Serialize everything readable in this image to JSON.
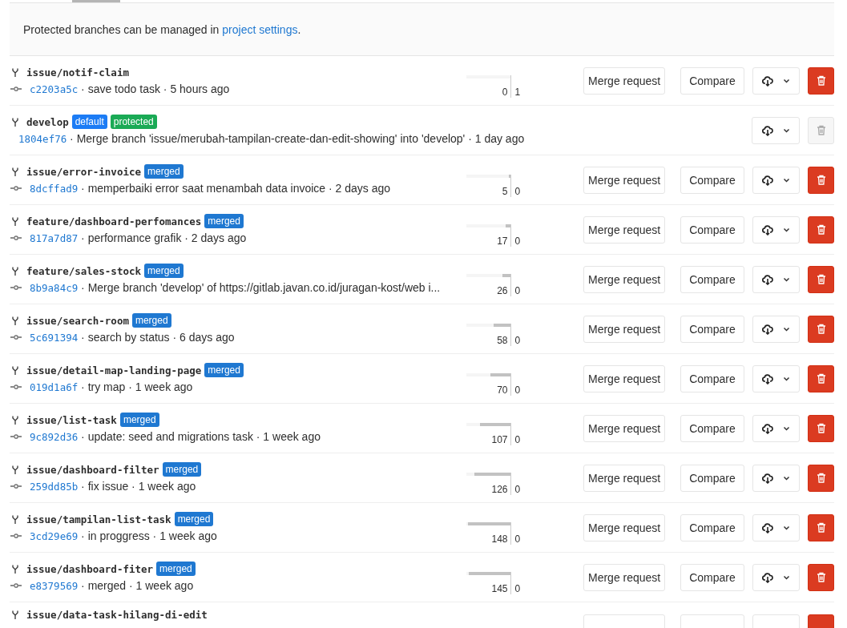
{
  "notice": {
    "text": "Protected branches can be managed in ",
    "link": "project settings",
    "end": "."
  },
  "branches": [
    {
      "name": "issue/notif-claim",
      "sha": "c2203a5c",
      "message": " · save todo task · 5 hours ago",
      "behind": "0",
      "ahead": "1",
      "level": 0,
      "actions": [
        "Merge request",
        "Compare"
      ],
      "can_delete": true
    },
    {
      "name": "develop",
      "badges": [
        {
          "label": "default",
          "kind": "default"
        },
        {
          "label": "protected",
          "kind": "protected"
        }
      ],
      "sha": "1804ef76",
      "message": " · Merge branch 'issue/merubah-tampilan-create-dan-edit-showing' into 'develop' · 1 day ago",
      "can_delete": false
    },
    {
      "name": "issue/error-invoice",
      "badges": [
        {
          "label": "merged",
          "kind": "merged"
        }
      ],
      "sha": "8dcffad9",
      "message": " · memperbaiki error saat menambah data invoice · 2 days ago",
      "behind": "5",
      "ahead": "0",
      "level": 0.03,
      "actions": [
        "Merge request",
        "Compare"
      ],
      "can_delete": true
    },
    {
      "name": "feature/dashboard-perfomances",
      "badges": [
        {
          "label": "merged",
          "kind": "merged"
        }
      ],
      "sha": "817a7d87",
      "message": " · performance grafik · 2 days ago",
      "behind": "17",
      "ahead": "0",
      "level": 0.11,
      "actions": [
        "Merge request",
        "Compare"
      ],
      "can_delete": true
    },
    {
      "name": "feature/sales-stock",
      "badges": [
        {
          "label": "merged",
          "kind": "merged"
        }
      ],
      "sha": "8b9a84c9",
      "message": " · Merge branch 'develop' of https://gitlab.javan.co.id/juragan-kost/web i...",
      "behind": "26",
      "ahead": "0",
      "level": 0.17,
      "actions": [
        "Merge request",
        "Compare"
      ],
      "can_delete": true
    },
    {
      "name": "issue/search-room",
      "badges": [
        {
          "label": "merged",
          "kind": "merged"
        }
      ],
      "sha": "5c691394",
      "message": " · search by status · 6 days ago",
      "behind": "58",
      "ahead": "0",
      "level": 0.37,
      "actions": [
        "Merge request",
        "Compare"
      ],
      "can_delete": true
    },
    {
      "name": "issue/detail-map-landing-page",
      "badges": [
        {
          "label": "merged",
          "kind": "merged"
        }
      ],
      "sha": "019d1a6f",
      "message": " · try map · 1 week ago",
      "behind": "70",
      "ahead": "0",
      "level": 0.45,
      "actions": [
        "Merge request",
        "Compare"
      ],
      "can_delete": true
    },
    {
      "name": "issue/list-task",
      "badges": [
        {
          "label": "merged",
          "kind": "merged"
        }
      ],
      "sha": "9c892d36",
      "message": " · update: seed and migrations task · 1 week ago",
      "behind": "107",
      "ahead": "0",
      "level": 0.69,
      "actions": [
        "Merge request",
        "Compare"
      ],
      "can_delete": true
    },
    {
      "name": "issue/dashboard-filter",
      "badges": [
        {
          "label": "merged",
          "kind": "merged"
        }
      ],
      "sha": "259dd85b",
      "message": " · fix issue · 1 week ago",
      "behind": "126",
      "ahead": "0",
      "level": 0.81,
      "actions": [
        "Merge request",
        "Compare"
      ],
      "can_delete": true
    },
    {
      "name": "issue/tampilan-list-task",
      "badges": [
        {
          "label": "merged",
          "kind": "merged"
        }
      ],
      "sha": "3cd29e69",
      "message": " · in proggress · 1 week ago",
      "behind": "148",
      "ahead": "0",
      "level": 0.95,
      "actions": [
        "Merge request",
        "Compare"
      ],
      "can_delete": true
    },
    {
      "name": "issue/dashboard-fiter",
      "badges": [
        {
          "label": "merged",
          "kind": "merged"
        }
      ],
      "sha": "e8379569",
      "message": " · merged · 1 week ago",
      "behind": "145",
      "ahead": "0",
      "level": 0.94,
      "actions": [
        "Merge request",
        "Compare"
      ],
      "can_delete": true
    },
    {
      "name": "issue/data-task-hilang-di-edit",
      "kind": "cut",
      "can_delete": true
    }
  ]
}
